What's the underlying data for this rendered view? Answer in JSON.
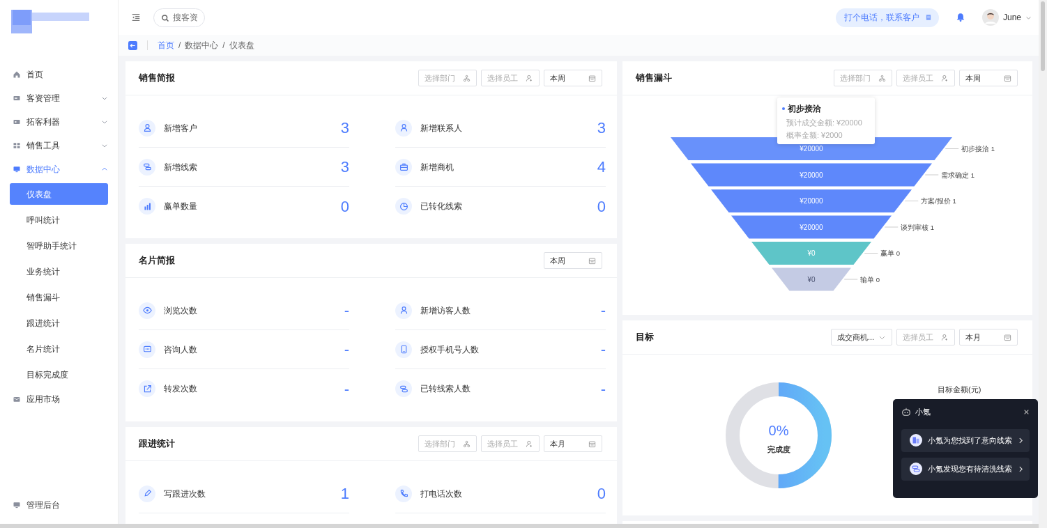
{
  "sidebar": {
    "items": [
      {
        "label": "首页",
        "selected": false
      },
      {
        "label": "客资管理",
        "selected": false,
        "expanded": false
      },
      {
        "label": "拓客利器",
        "selected": false,
        "expanded": false
      },
      {
        "label": "销售工具",
        "selected": false,
        "expanded": false
      },
      {
        "label": "数据中心",
        "selected": true,
        "expanded": true,
        "children": [
          {
            "label": "仪表盘",
            "selected": true
          },
          {
            "label": "呼叫统计",
            "selected": false
          },
          {
            "label": "智呼助手统计",
            "selected": false
          },
          {
            "label": "业务统计",
            "selected": false
          },
          {
            "label": "销售漏斗",
            "selected": false
          },
          {
            "label": "跟进统计",
            "selected": false
          },
          {
            "label": "名片统计",
            "selected": false
          },
          {
            "label": "目标完成度",
            "selected": false
          }
        ]
      },
      {
        "label": "应用市场",
        "selected": false
      }
    ],
    "footer": "管理后台"
  },
  "topbar": {
    "search_placeholder": "搜客资",
    "call_button": "打个电话，联系客户",
    "user": "June"
  },
  "breadcrumb": [
    {
      "label": "首页",
      "link": true
    },
    {
      "separator": "/",
      "label": "数据中心",
      "link": false
    },
    {
      "separator": "/",
      "label": "仪表盘",
      "link": false
    }
  ],
  "left_cards": [
    {
      "title": "销售简报",
      "filters": [
        {
          "kind": "dept",
          "placeholder": "选择部门"
        },
        {
          "kind": "staff",
          "placeholder": "选择员工"
        },
        {
          "kind": "date",
          "value": "本周"
        }
      ],
      "stats": [
        {
          "label": "新增客户",
          "value": "3"
        },
        {
          "label": "新增联系人",
          "value": "3"
        },
        {
          "label": "新增线索",
          "value": "3"
        },
        {
          "label": "新增商机",
          "value": "4"
        },
        {
          "label": "赢单数量",
          "value": "0"
        },
        {
          "label": "已转化线索",
          "value": "0"
        }
      ]
    },
    {
      "title": "名片简报",
      "filters": [
        {
          "kind": "date",
          "value": "本周"
        }
      ],
      "stats": [
        {
          "label": "浏览次数",
          "value": "-"
        },
        {
          "label": "新增访客人数",
          "value": "-"
        },
        {
          "label": "咨询人数",
          "value": "-"
        },
        {
          "label": "授权手机号人数",
          "value": "-"
        },
        {
          "label": "转发次数",
          "value": "-"
        },
        {
          "label": "已转线索人数",
          "value": "-"
        }
      ]
    },
    {
      "title": "跟进统计",
      "filters": [
        {
          "kind": "dept",
          "placeholder": "选择部门"
        },
        {
          "kind": "staff",
          "placeholder": "选择员工"
        },
        {
          "kind": "date",
          "value": "本月"
        }
      ],
      "stats": [
        {
          "label": "写跟进次数",
          "value": "1"
        },
        {
          "label": "打电话次数",
          "value": "0"
        }
      ]
    }
  ],
  "funnel_card": {
    "title": "销售漏斗",
    "filters": [
      {
        "kind": "dept",
        "placeholder": "选择部门"
      },
      {
        "kind": "staff",
        "placeholder": "选择员工"
      },
      {
        "kind": "date",
        "value": "本周"
      }
    ],
    "stages": [
      {
        "label": "初步接洽 1",
        "amount": "¥20000",
        "color": "#6891fb"
      },
      {
        "label": "需求确定 1",
        "amount": "¥20000",
        "color": "#5e88fb"
      },
      {
        "label": "方案/报价 1",
        "amount": "¥20000",
        "color": "#5e88fb"
      },
      {
        "label": "谈判审核 1",
        "amount": "¥20000",
        "color": "#5e88fb"
      },
      {
        "label": "赢单 0",
        "amount": "¥0",
        "color": "#5ec5c8"
      },
      {
        "label": "输单 0",
        "amount": "¥0",
        "color": "#c4cbe4"
      }
    ],
    "tooltip": {
      "title": "初步接洽",
      "lines": [
        "预计成交金额: ¥20000",
        "概率金额: ¥2000"
      ]
    }
  },
  "goal_card": {
    "title": "目标",
    "filters": [
      {
        "kind": "select",
        "value": "成交商机..."
      },
      {
        "kind": "staff",
        "placeholder": "选择员工"
      },
      {
        "kind": "date",
        "value": "本月"
      }
    ],
    "ring": {
      "level": 0.5,
      "percent": "0%",
      "caption": "完成度"
    },
    "legend": "目标金额(元)"
  },
  "assistant": {
    "name": "小氪",
    "items": [
      "小氪为您找到了意向线索",
      "小氪发现您有待清洗线索"
    ]
  }
}
